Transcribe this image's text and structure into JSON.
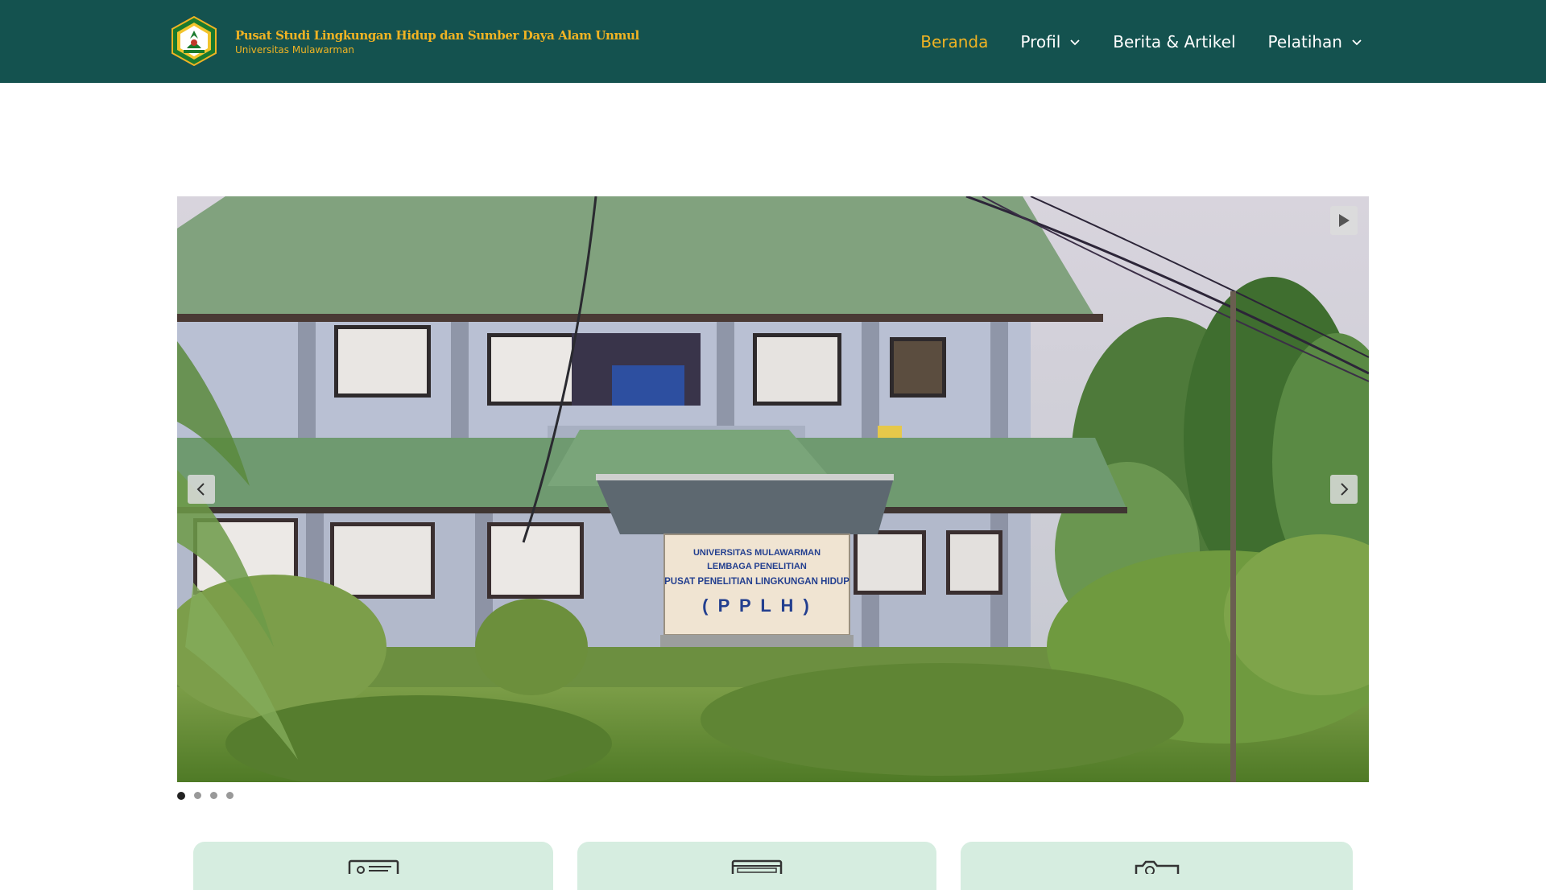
{
  "header": {
    "logo_icon": "university-emblem-icon",
    "brand_title": "Pusat Studi Lingkungan Hidup dan Sumber Daya Alam Unmul",
    "brand_subtitle": "Universitas Mulawarman",
    "colors": {
      "background": "#14524f",
      "accent": "#f0b323",
      "nav_text": "#ffffff"
    }
  },
  "nav": {
    "items": [
      {
        "label": "Beranda",
        "active": true,
        "has_dropdown": false
      },
      {
        "label": "Profil",
        "active": false,
        "has_dropdown": true
      },
      {
        "label": "Berita & Artikel",
        "active": false,
        "has_dropdown": false
      },
      {
        "label": "Pelatihan",
        "active": false,
        "has_dropdown": true
      }
    ],
    "dropdown_icon": "chevron-down-icon"
  },
  "slider": {
    "image_icon": "building-photo",
    "sign_lines": [
      "UNIVERSITAS MULAWARMAN",
      "LEMBAGA PENELITIAN",
      "PUSAT PENELITIAN LINGKUNGAN HIDUP",
      "( P P L H )"
    ],
    "play_icon": "play-icon",
    "prev_icon": "chevron-left-icon",
    "next_icon": "chevron-right-icon",
    "slide_count": 4,
    "current_slide": 1
  },
  "cards": {
    "items": [
      {
        "icon": "certificate-icon"
      },
      {
        "icon": "browser-window-icon"
      },
      {
        "icon": "camera-icon"
      }
    ],
    "color": "#d6ede0"
  }
}
